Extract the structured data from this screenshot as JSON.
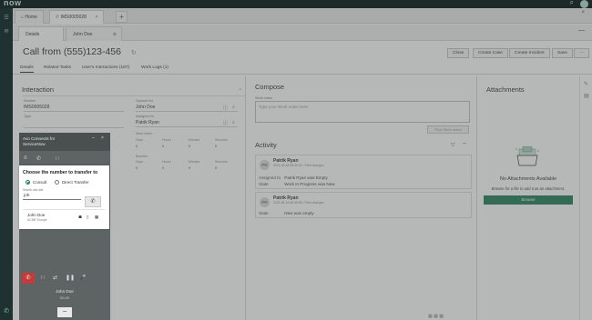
{
  "topbar": {
    "brand": "now"
  },
  "tabs": [
    {
      "label": "Home",
      "icon": "home-icon"
    },
    {
      "label": "IMS0005028",
      "icon": "phone-icon"
    }
  ],
  "subtabs": [
    {
      "label": "Details"
    },
    {
      "label": "John Doe"
    }
  ],
  "record": {
    "title": "Call from (555)123-456",
    "buttons": [
      "Close",
      "Create Case",
      "Create Incident",
      "Save"
    ],
    "more": "⋯",
    "tabs": [
      "Details",
      "Related Tasks",
      "User's Interactions (187)",
      "Work Logs (1)"
    ]
  },
  "interaction": {
    "title": "Interaction",
    "number_label": "Number",
    "number_value": "IMS0005028",
    "type_label": "Type",
    "opened_for_label": "Opened for",
    "opened_for_value": "John Doe",
    "assigned_to_label": "Assigned to",
    "assigned_to_value": "Patrik Ryan",
    "work_notes_label": "Work Notes",
    "baseline_label": "Baseline",
    "stats_headers": [
      "Days",
      "Hours",
      "Minutes",
      "Seconds"
    ],
    "stats_values": [
      "0",
      "0",
      "0",
      "0"
    ]
  },
  "compose": {
    "title": "Compose",
    "work_notes_label": "Work notes",
    "placeholder": "Type your Work notes here",
    "post_button": "Post Work notes"
  },
  "activity": {
    "title": "Activity",
    "entries": [
      {
        "initials": "PR",
        "name": "Patrik Ryan",
        "meta": "2021-06-18 08:49:04 • Field changes",
        "rows": [
          {
            "key": "Assigned to",
            "value": "Patrik Ryan was Empty"
          },
          {
            "key": "State",
            "value": "Work In Progress was New"
          }
        ]
      },
      {
        "initials": "PR",
        "name": "Patrik Ryan",
        "meta": "2021-06-18 08:49:08 • Field changes",
        "rows": [
          {
            "key": "State",
            "value": "New was empty"
          }
        ]
      }
    ]
  },
  "attachments": {
    "title": "Attachments",
    "empty_text": "No Attachments Available",
    "browse_text": "Browse for a file to add it as an attachment.",
    "browse_button": "Browse"
  },
  "phone_widget": {
    "title_line1": "Avo Connects for",
    "title_line2": "ServiceNow",
    "caller": "John Doe",
    "call_time": "00:00"
  },
  "transfer_dialog": {
    "title": "Choose the number to transfer to",
    "option_consult": "Consult",
    "option_direct": "Direct Transfer",
    "search_label": "Search and dial",
    "search_value": "joh",
    "result_name": "John Doe",
    "result_sub": "ACME Europe"
  },
  "colors": {
    "accent": "#1f7a55",
    "hangup": "#c33b3b",
    "rail": "#1f3131",
    "topbar": "#1d2a2a"
  }
}
